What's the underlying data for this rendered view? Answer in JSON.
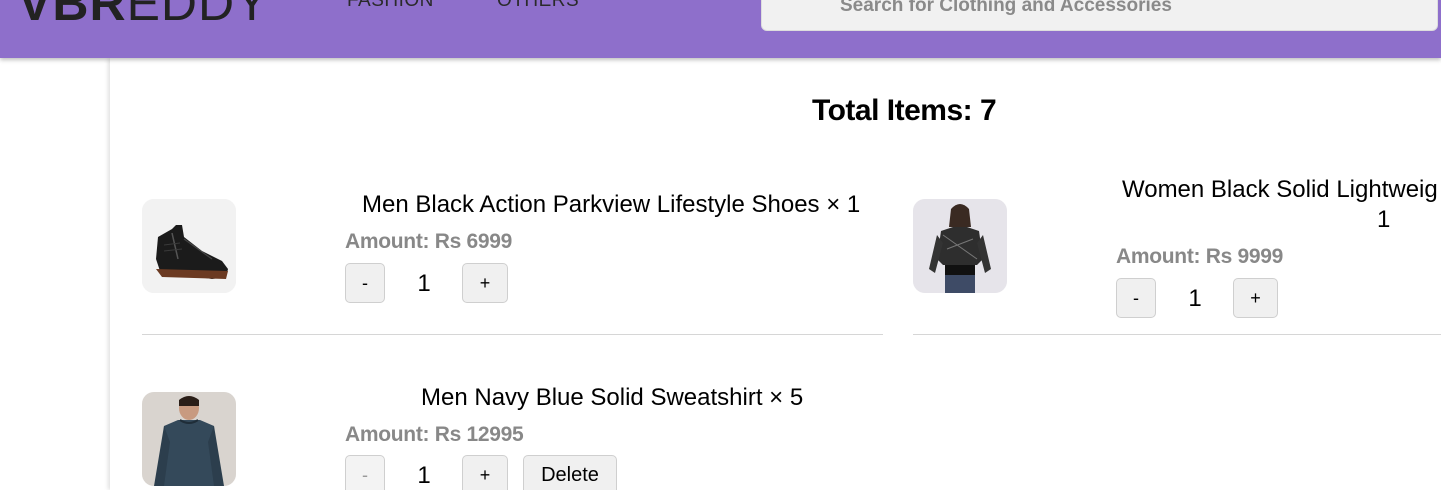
{
  "header": {
    "logo_bold": "VBR",
    "logo_light": "EDDY",
    "nav": [
      "FASHION",
      "OTHERS"
    ],
    "search_placeholder": "Search for Clothing and Accessories",
    "background_color": "#8e6fcb"
  },
  "cart": {
    "total_label": "Total Items: 7",
    "items": [
      {
        "name": "Men Black Action Parkview Lifestyle Shoes × 1",
        "amount": "Amount: Rs 6999",
        "quantity": "1",
        "minus": "-",
        "plus": "+"
      },
      {
        "name": "Women Black Solid Lightweig",
        "name_line2": "1",
        "amount": "Amount: Rs 9999",
        "quantity": "1",
        "minus": "-",
        "plus": "+"
      },
      {
        "name": "Men Navy Blue Solid Sweatshirt × 5",
        "amount": "Amount: Rs 12995",
        "quantity": "1",
        "minus": "-",
        "plus": "+",
        "delete": "Delete"
      }
    ]
  }
}
